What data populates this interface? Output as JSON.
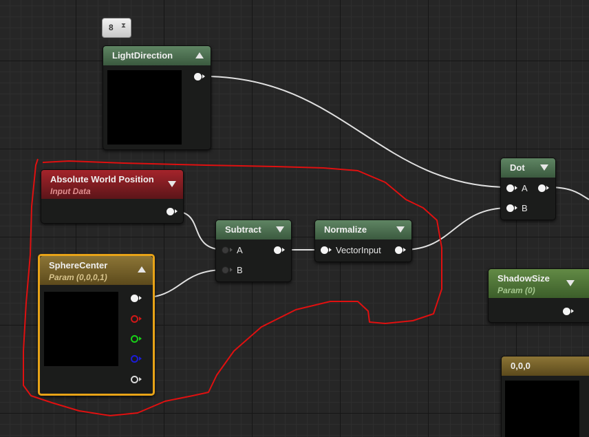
{
  "graph": {
    "comment_badge": {
      "text": "8",
      "icon": "mesh-icon"
    },
    "nodes": {
      "light_direction": {
        "title": "LightDirection"
      },
      "absolute_world_position": {
        "title": "Absolute World Position",
        "subtitle": "Input Data"
      },
      "subtract": {
        "title": "Subtract",
        "pin_a": "A",
        "pin_b": "B"
      },
      "normalize": {
        "title": "Normalize",
        "pin_input": "VectorInput"
      },
      "dot": {
        "title": "Dot",
        "pin_a": "A",
        "pin_b": "B"
      },
      "sphere_center": {
        "title": "SphereCenter",
        "subtitle": "Param (0,0,0,1)"
      },
      "shadow_size": {
        "title": "ShadowSize",
        "subtitle": "Param (0)"
      },
      "constant": {
        "title": "0,0,0"
      }
    },
    "colors": {
      "grid": "#262626",
      "wire": "#e0e0e0",
      "annotation": "#e01010",
      "selection": "#e8a317",
      "header_green": "#4e7352",
      "header_red": "#8e1f25",
      "header_gold": "#7a6530",
      "header_lime": "#52753a"
    }
  }
}
